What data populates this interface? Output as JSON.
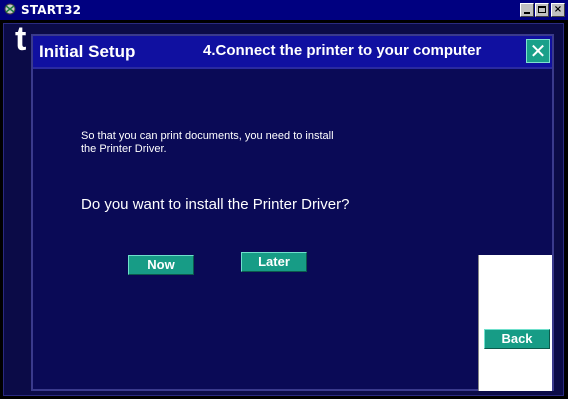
{
  "window": {
    "title": "START32",
    "controls": [
      "minimize",
      "maximize",
      "close"
    ]
  },
  "background_letter": "t",
  "dialog": {
    "title": "Initial Setup",
    "step_title": "4.Connect the printer to your computer",
    "close_symbol": "✕",
    "message_lines": [
      "So that you can print documents, you need to install",
      "the Printer Driver."
    ],
    "question": "Do you want to install the Printer Driver?",
    "buttons": {
      "now": "Now",
      "later": "Later",
      "back": "Back"
    }
  },
  "colors": {
    "background": "#0b0b47",
    "header": "#1010a0",
    "button": "#179c86",
    "titlebar": "#000080"
  }
}
